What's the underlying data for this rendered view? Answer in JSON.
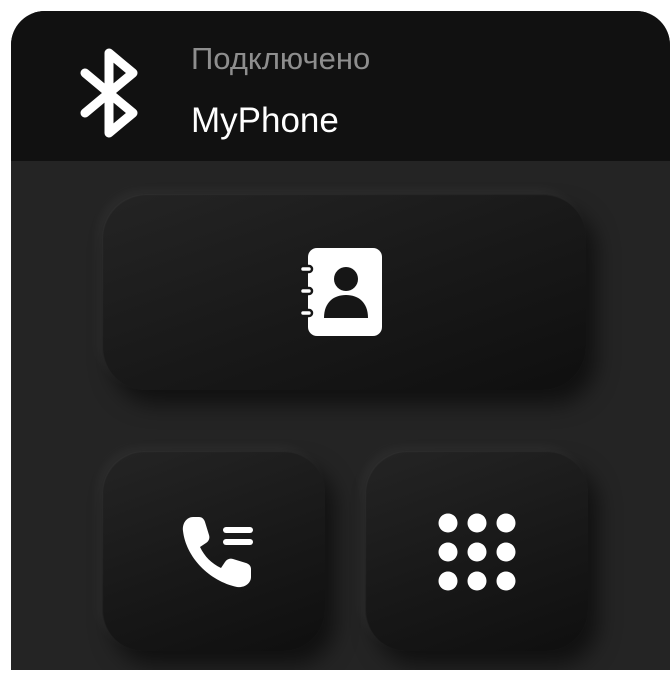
{
  "header": {
    "bluetooth_icon": "bluetooth-icon",
    "status": "Подключено",
    "device_name": "MyPhone"
  },
  "buttons": {
    "contacts": {
      "icon": "contacts-book-icon"
    },
    "calls": {
      "icon": "call-log-icon"
    },
    "dialpad": {
      "icon": "dialpad-icon"
    }
  },
  "colors": {
    "panel_background": "#242424",
    "header_background": "#111111",
    "button_background": "#181818",
    "icon": "#ffffff",
    "status_text": "#8e8e8e",
    "device_text": "#ffffff"
  }
}
